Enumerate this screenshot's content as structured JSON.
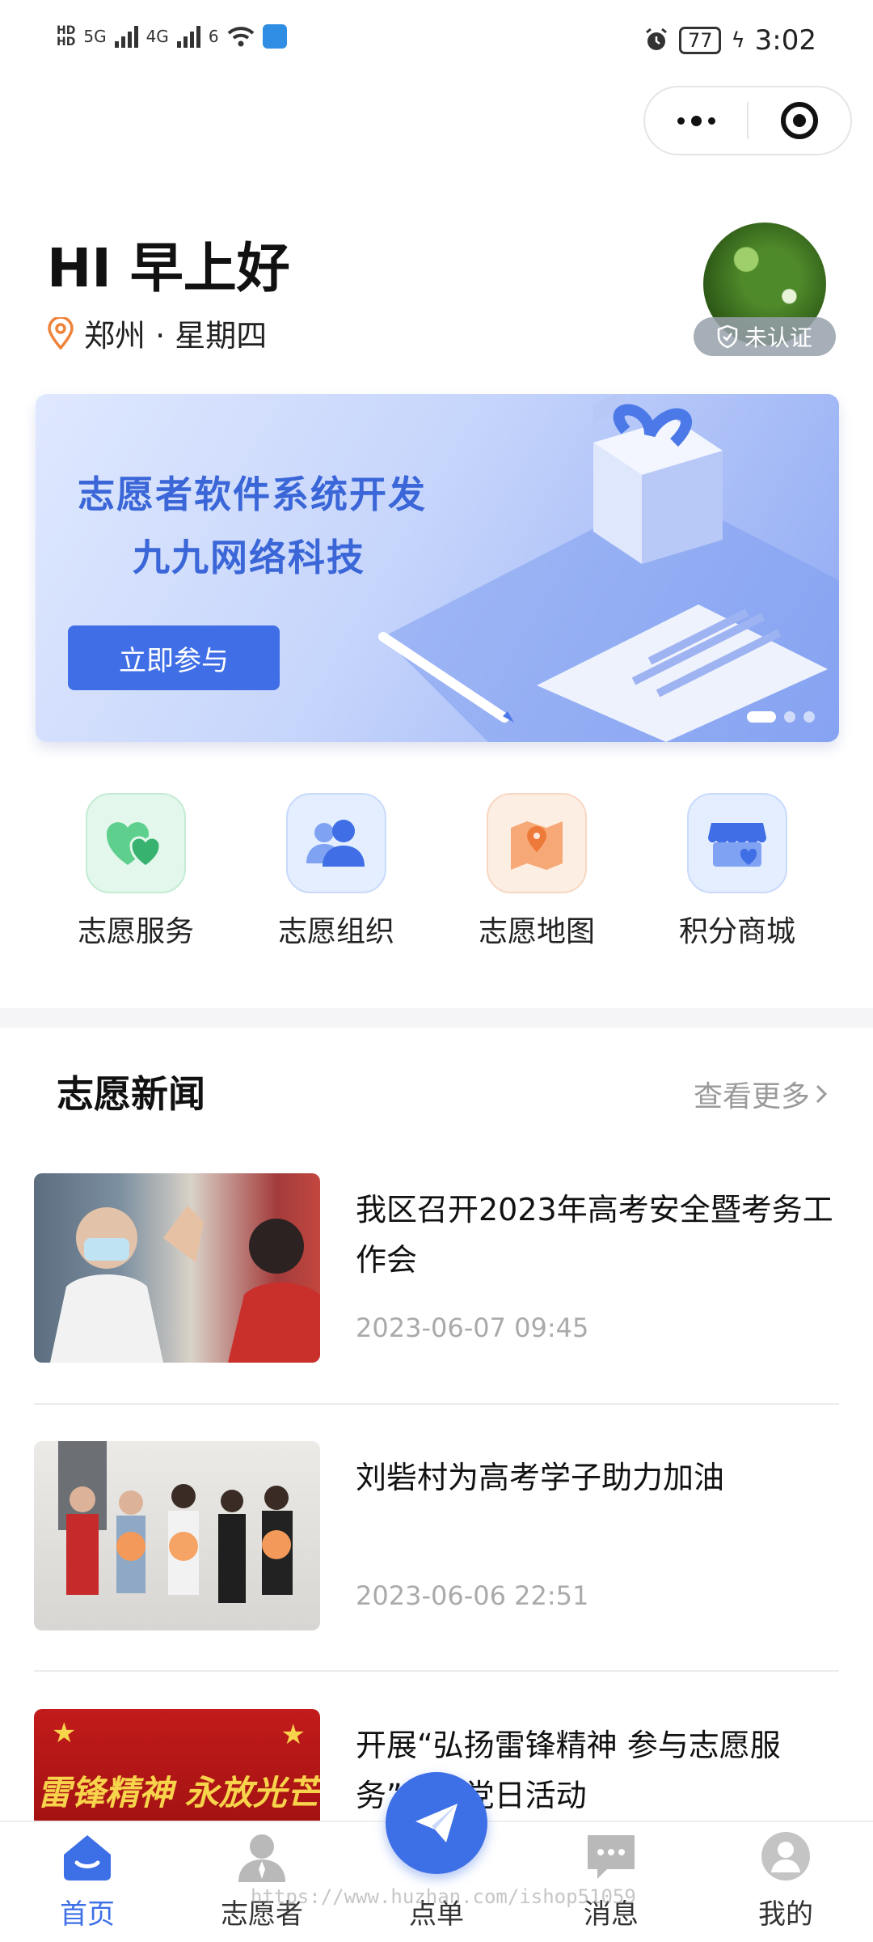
{
  "status_bar": {
    "network1": "5G",
    "network2": "4G",
    "wifi_label": "6",
    "battery": "77",
    "time": "3:02"
  },
  "header": {
    "greeting": "HI 早上好",
    "location": "郑州 · 星期四",
    "cert_status": "未认证"
  },
  "banner": {
    "line1": "志愿者软件系统开发",
    "line2": "九九网络科技",
    "button": "立即参与"
  },
  "quick_menu": [
    {
      "label": "志愿服务",
      "icon": "heart-icon"
    },
    {
      "label": "志愿组织",
      "icon": "people-icon"
    },
    {
      "label": "志愿地图",
      "icon": "map-icon"
    },
    {
      "label": "积分商城",
      "icon": "store-icon"
    }
  ],
  "news": {
    "title": "志愿新闻",
    "see_more": "查看更多",
    "items": [
      {
        "title": "我区召开2023年高考安全暨考务工作会",
        "date": "2023-06-07 09:45"
      },
      {
        "title": "刘砦村为高考学子助力加油",
        "date": "2023-06-06 22:51"
      },
      {
        "title": "开展“弘扬雷锋精神 参与志愿服务”主题党日活动",
        "date": ""
      }
    ],
    "thumb3_text": "雷锋精神 永放光芒"
  },
  "tab_bar": [
    {
      "label": "首页",
      "icon": "home-icon"
    },
    {
      "label": "志愿者",
      "icon": "volunteer-icon"
    },
    {
      "label": "点单",
      "icon": "paper-plane-icon"
    },
    {
      "label": "消息",
      "icon": "message-icon"
    },
    {
      "label": "我的",
      "icon": "profile-icon"
    }
  ],
  "watermark": "https://www.huzhan.com/ishop51059",
  "colors": {
    "accent": "#3d6fe6",
    "banner_text": "#3a66d8"
  }
}
